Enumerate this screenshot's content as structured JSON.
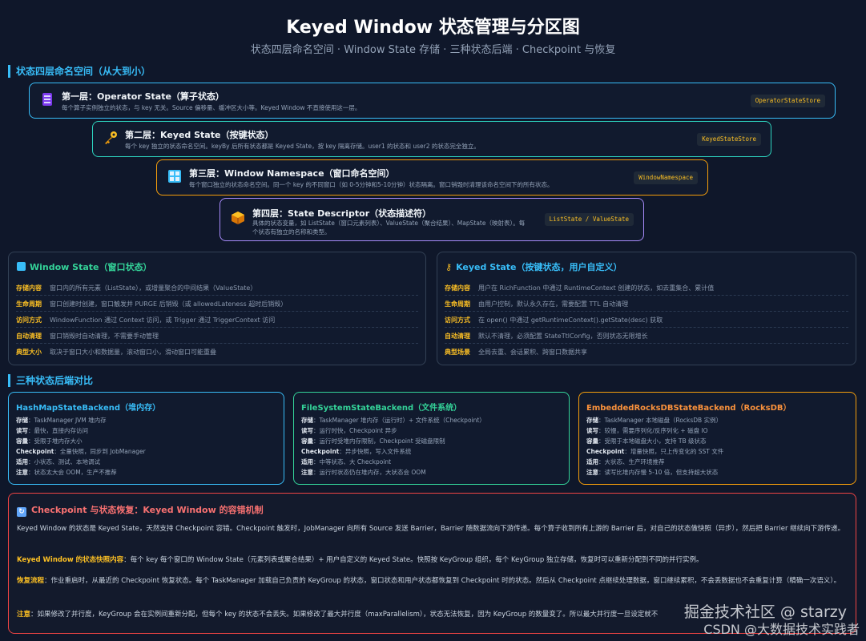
{
  "header": {
    "title": "Keyed Window 状态管理与分区图",
    "subtitle": "状态四层命名空间 · Window State 存储 · 三种状态后端 · Checkpoint 与恢复"
  },
  "section_layers": "状态四层命名空间（从大到小）",
  "layers": [
    {
      "icon": "operator-state-icon",
      "title": "第一层：Operator State（算子状态）",
      "desc": "每个算子实例独立的状态，与 key 无关。Source 偏移量、缓冲区大小等。Keyed Window 不直接使用这一层。",
      "tag": "OperatorStateStore",
      "color": "#38bdf8"
    },
    {
      "icon": "key-icon",
      "title": "第二层：Keyed State（按键状态）",
      "desc": "每个 key 独立的状态命名空间。keyBy 后所有状态都是 Keyed State，按 key 隔离存储。user1 的状态和 user2 的状态完全独立。",
      "tag": "KeyedStateStore",
      "color": "#2dd4bf"
    },
    {
      "icon": "window-icon",
      "title": "第三层：Window Namespace（窗口命名空间）",
      "desc": "每个窗口独立的状态命名空间。同一个 key 的不同窗口（如 0-5分钟和5-10分钟）状态隔离。窗口销毁时清理该命名空间下的所有状态。",
      "tag": "WindowNamespace",
      "color": "#f59e0b"
    },
    {
      "icon": "package-icon",
      "title": "第四层：State Descriptor（状态描述符）",
      "desc_lines": [
        "具体的状态变量，如 ListState（窗口元素列表）、ValueState（聚合结果）、MapState（映射表）。每",
        "个状态有独立的名称和类型。"
      ],
      "tag": "ListState / ValueState",
      "color": "#a78bfa"
    }
  ],
  "window_state": {
    "title": "Window State（窗口状态）",
    "rows": [
      {
        "k": "存储内容",
        "v": "窗口内的所有元素（ListState），或增量聚合的中间结果（ValueState）"
      },
      {
        "k": "生命周期",
        "v": "窗口创建时创建，窗口触发并 PURGE 后销毁（或 allowedLateness 超时后销毁）"
      },
      {
        "k": "访问方式",
        "v": "WindowFunction 通过 Context 访问，或 Trigger 通过 TriggerContext 访问"
      },
      {
        "k": "自动清理",
        "v": "窗口销毁时自动清理，不需要手动管理"
      },
      {
        "k": "典型大小",
        "v": "取决于窗口大小和数据量，滚动窗口小，滑动窗口可能重叠"
      }
    ]
  },
  "keyed_state": {
    "title": "Keyed State（按键状态，用户自定义）",
    "rows": [
      {
        "k": "存储内容",
        "v": "用户在 RichFunction 中通过 RuntimeContext 创建的状态，如去重集合、累计值"
      },
      {
        "k": "生命周期",
        "v": "由用户控制，默认永久存在，需要配置 TTL 自动清理"
      },
      {
        "k": "访问方式",
        "v": "在 open() 中通过 getRuntimeContext().getState(desc) 获取"
      },
      {
        "k": "自动清理",
        "v": "默认不清理，必须配置 StateTtlConfig，否则状态无限增长"
      },
      {
        "k": "典型场景",
        "v": "全局去重、会话累积、跨窗口数据共享"
      }
    ]
  },
  "section_backends": "三种状态后端对比",
  "backends": [
    {
      "title": "HashMapStateBackend（堆内存）",
      "color": "#38bdf8",
      "rows": [
        {
          "k": "存储",
          "v": "TaskManager JVM 堆内存"
        },
        {
          "k": "读写",
          "v": "最快，直接内存访问"
        },
        {
          "k": "容量",
          "v": "受限于堆内存大小"
        },
        {
          "k": "Checkpoint",
          "v": "全量快照，同步到 JobManager"
        },
        {
          "k": "适用",
          "v": "小状态、测试、本地调试"
        },
        {
          "k": "注意",
          "v": "状态太大会 OOM，生产不推荐"
        }
      ]
    },
    {
      "title": "FileSystemStateBackend（文件系统）",
      "color": "#34d399",
      "rows": [
        {
          "k": "存储",
          "v": "TaskManager 堆内存（运行时）+ 文件系统（Checkpoint）"
        },
        {
          "k": "读写",
          "v": "运行时快，Checkpoint 异步"
        },
        {
          "k": "容量",
          "v": "运行时受堆内存限制，Checkpoint 受磁盘限制"
        },
        {
          "k": "Checkpoint",
          "v": "异步快照，写入文件系统"
        },
        {
          "k": "适用",
          "v": "中等状态、大 Checkpoint"
        },
        {
          "k": "注意",
          "v": "运行时状态仍在堆内存，大状态会 OOM"
        }
      ]
    },
    {
      "title": "EmbeddedRocksDBStateBackend（RocksDB）",
      "color": "#fb923c",
      "rows": [
        {
          "k": "存储",
          "v": "TaskManager 本地磁盘（RocksDB 实例）"
        },
        {
          "k": "读写",
          "v": "较慢，需要序列化/反序列化 + 磁盘 IO"
        },
        {
          "k": "容量",
          "v": "受限于本地磁盘大小，支持 TB 级状态"
        },
        {
          "k": "Checkpoint",
          "v": "增量快照，只上传变化的 SST 文件"
        },
        {
          "k": "适用",
          "v": "大状态、生产环境推荐"
        },
        {
          "k": "注意",
          "v": "读写比堆内存慢 5-10 倍，但支持超大状态"
        }
      ]
    }
  ],
  "checkpoint": {
    "title": "Checkpoint 与状态恢复：Keyed Window 的容错机制",
    "p1": "Keyed Window 的状态是 Keyed State，天然支持 Checkpoint 容错。Checkpoint 触发时，JobManager 向所有 Source 发送 Barrier，Barrier 随数据流向下游传递。每个算子收到所有上游的 Barrier 后，对自己的状态做快照（异步），然后把 Barrier 继续向下游传递。",
    "p2_hl": "Keyed Window 的状态快照内容",
    "p2": "：每个 key 每个窗口的 Window State（元素列表或聚合结果）+ 用户自定义的 Keyed State。快照按 KeyGroup 组织，每个 KeyGroup 独立存储，恢复时可以重新分配到不同的并行实例。",
    "p3_hl": "恢复流程",
    "p3": "：作业重启时，从最近的 Checkpoint 恢复状态。每个 TaskManager 加载自己负责的 KeyGroup 的状态，窗口状态和用户状态都恢复到 Checkpoint 时的状态。然后从 Checkpoint 点继续处理数据，窗口继续累积，不会丢数据也不会重复计算（精确一次语义）。",
    "p4_hl": "注意",
    "p4": "：如果修改了并行度，KeyGroup 会在实例间重新分配，但每个 key 的状态不会丢失。如果修改了最大并行度（maxParallelism），状态无法恢复，因为 KeyGroup 的数量变了。所以最大并行度一旦设定就不要改。"
  },
  "watermark": {
    "line1": "掘金技术社区 @ starzy",
    "line2": "CSDN @大数据技术实践者"
  }
}
